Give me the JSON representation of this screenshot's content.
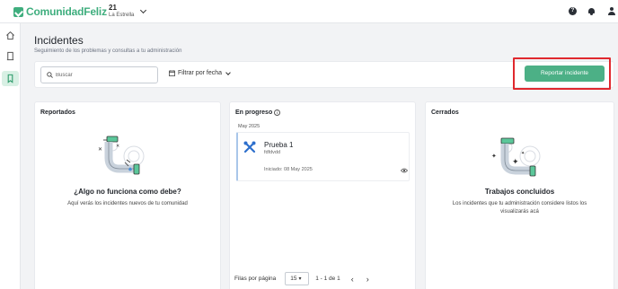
{
  "brand": {
    "name": "ComunidadFeliz"
  },
  "community": {
    "number": "21",
    "name": "La Estrella"
  },
  "header_icons": {
    "help": "?"
  },
  "page": {
    "title": "Incidentes",
    "subtitle": "Seguimiento de los problemas y consultas a tu administración"
  },
  "toolbar": {
    "search_placeholder": "Buscar",
    "filter_label": "Filtrar por fecha",
    "report_button": "Reportar incidente"
  },
  "columns": {
    "reported": {
      "title": "Reportados",
      "empty_title": "¿Algo no funciona como debe?",
      "empty_text": "Aquí verás los incidentes nuevos de tu comunidad"
    },
    "in_progress": {
      "title": "En progreso",
      "info_glyph": "i",
      "month": "May 2025",
      "card": {
        "title": "Prueba 1",
        "subtitle": "fdfdvdd",
        "date": "Iniciado: 08 May 2025"
      },
      "pagination": {
        "rows_label": "Filas por página",
        "rows_value": "15",
        "range": "1 - 1 de 1",
        "prev": "‹",
        "next": "›"
      }
    },
    "closed": {
      "title": "Cerrados",
      "empty_title": "Trabajos concluidos",
      "empty_text": "Los incidentes que tu administración considere listos los visualizarás acá"
    }
  },
  "colors": {
    "brand": "#3fae7e",
    "button": "#4cb086",
    "highlight": "#e0282e"
  }
}
